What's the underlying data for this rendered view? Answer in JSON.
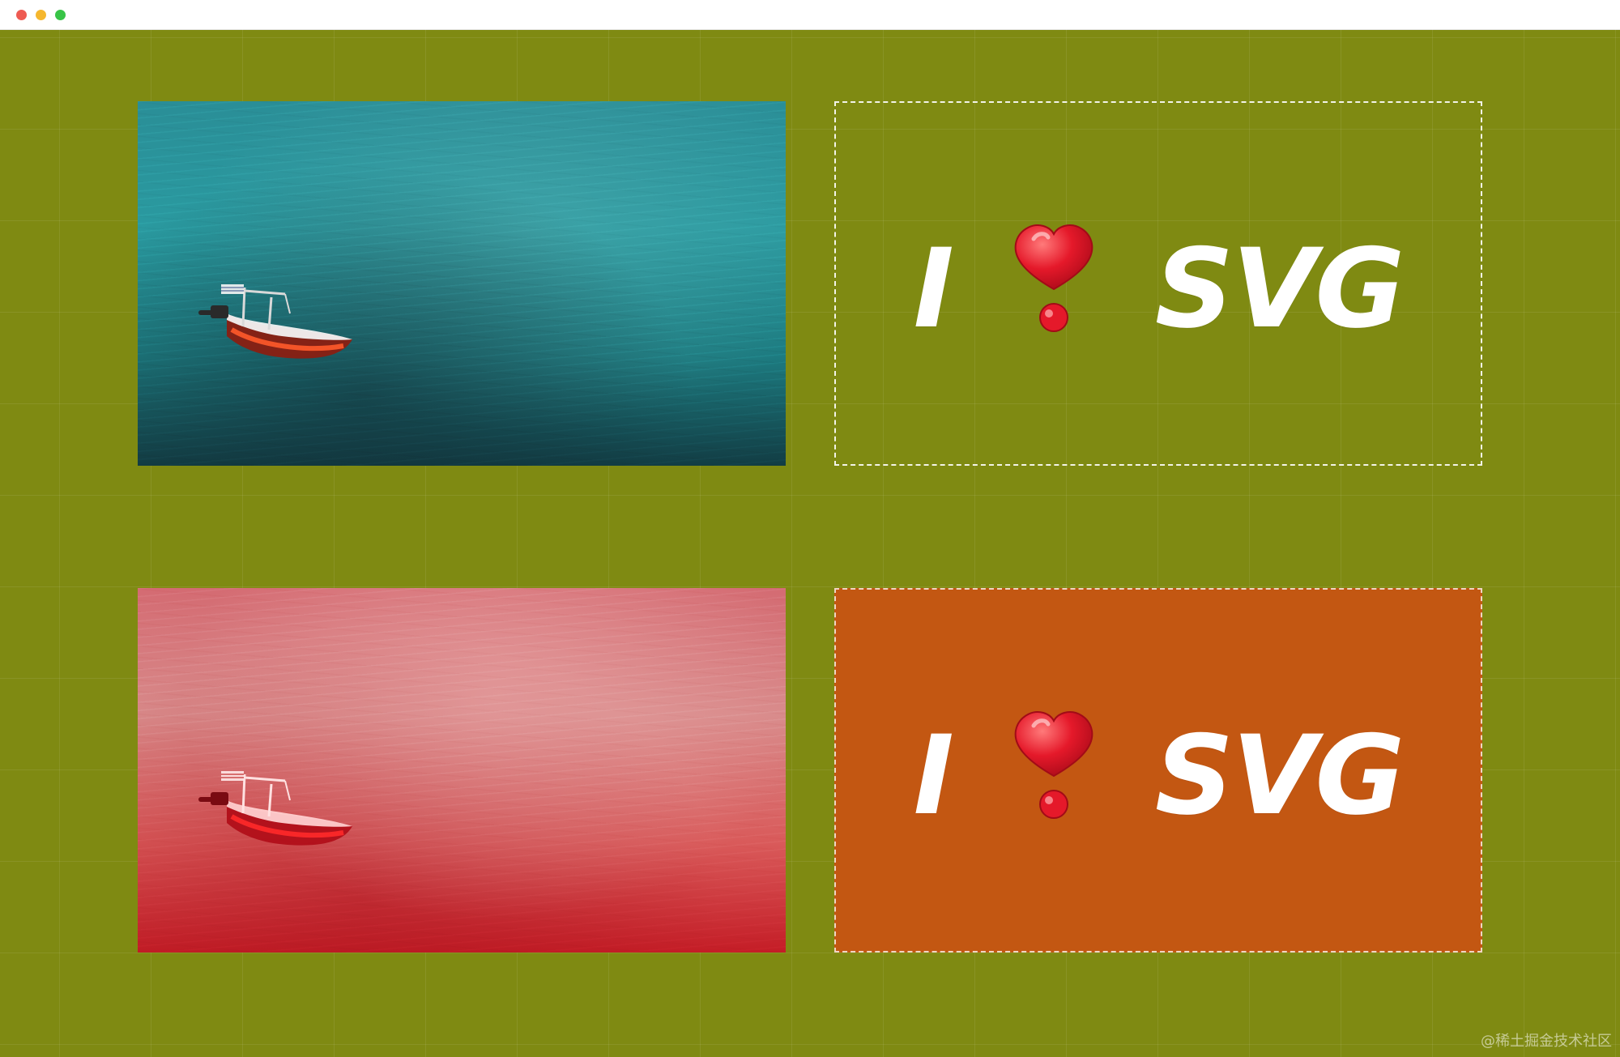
{
  "window": {
    "controls": [
      "close",
      "minimize",
      "maximize"
    ]
  },
  "panels": [
    {
      "kind": "photo",
      "filter": "original"
    },
    {
      "kind": "text",
      "text_left": "I",
      "symbol": "heart-icon",
      "text_right": "SVG"
    },
    {
      "kind": "photo",
      "filter": "red-tint"
    },
    {
      "kind": "text",
      "text_left": "I",
      "symbol": "heart-icon",
      "text_right": "SVG"
    }
  ],
  "colors": {
    "background": "#7f8a12",
    "accent_orange": "#c35712",
    "heart_red": "#e5192a",
    "text_white": "#ffffff"
  },
  "watermark": {
    "text": "@稀土掘金技术社区"
  }
}
